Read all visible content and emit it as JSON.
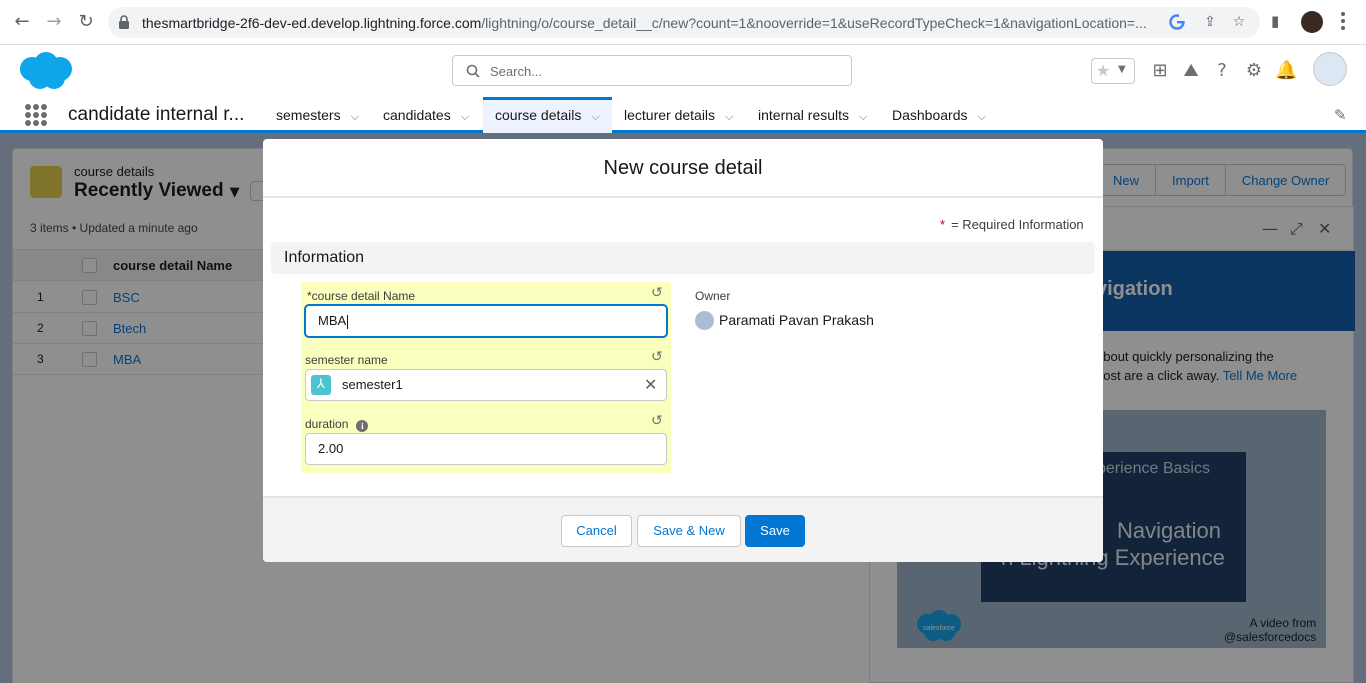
{
  "browser": {
    "url_host": "thesmartbridge-2f6-dev-ed.develop.lightning.force.com",
    "url_path": "/lightning/o/course_detail__c/new?count=1&nooverride=1&useRecordTypeCheck=1&navigationLocation=..."
  },
  "header": {
    "search_placeholder": "Search..."
  },
  "app_nav": {
    "app_name": "candidate internal r...",
    "tabs": [
      {
        "label": "semesters"
      },
      {
        "label": "candidates"
      },
      {
        "label": "course details",
        "active": true
      },
      {
        "label": "lecturer details"
      },
      {
        "label": "internal results"
      },
      {
        "label": "Dashboards"
      }
    ]
  },
  "list_view": {
    "object_label": "course details",
    "view_name": "Recently Viewed",
    "meta": "3 items • Updated a minute ago",
    "actions": [
      "New",
      "Import",
      "Change Owner"
    ],
    "column_header": "course detail Name",
    "rows": [
      {
        "num": "1",
        "name": "BSC"
      },
      {
        "num": "2",
        "name": "Btech"
      },
      {
        "num": "3",
        "name": "MBA"
      }
    ]
  },
  "utility_panel": {
    "banner_title": "vigation",
    "text_line1": "about quickly personalizing the",
    "text_line2": "nost are a click away.",
    "link": "Tell Me More",
    "video_t1": "perience Basics",
    "video_t2": "Navigation",
    "video_t3": "n Lightning Experience",
    "video_from_1": "A video from",
    "video_from_2": "@salesforcedocs",
    "logo_text": "salesforce"
  },
  "modal": {
    "title": "New course detail",
    "required_note": "= Required Information",
    "required_star": "*",
    "section": "Information",
    "fields": {
      "name_label": "course detail Name",
      "name_value": "MBA",
      "semester_label": "semester name",
      "semester_value": "semester1",
      "duration_label": "duration",
      "duration_value": "2.00"
    },
    "owner_label": "Owner",
    "owner_name": "Paramati Pavan Prakash",
    "buttons": {
      "cancel": "Cancel",
      "save_new": "Save & New",
      "save": "Save"
    }
  },
  "colors": {
    "brand": "#0176d3",
    "highlight": "#faffbd",
    "overlay": "rgba(8,7,7,0.45)"
  }
}
